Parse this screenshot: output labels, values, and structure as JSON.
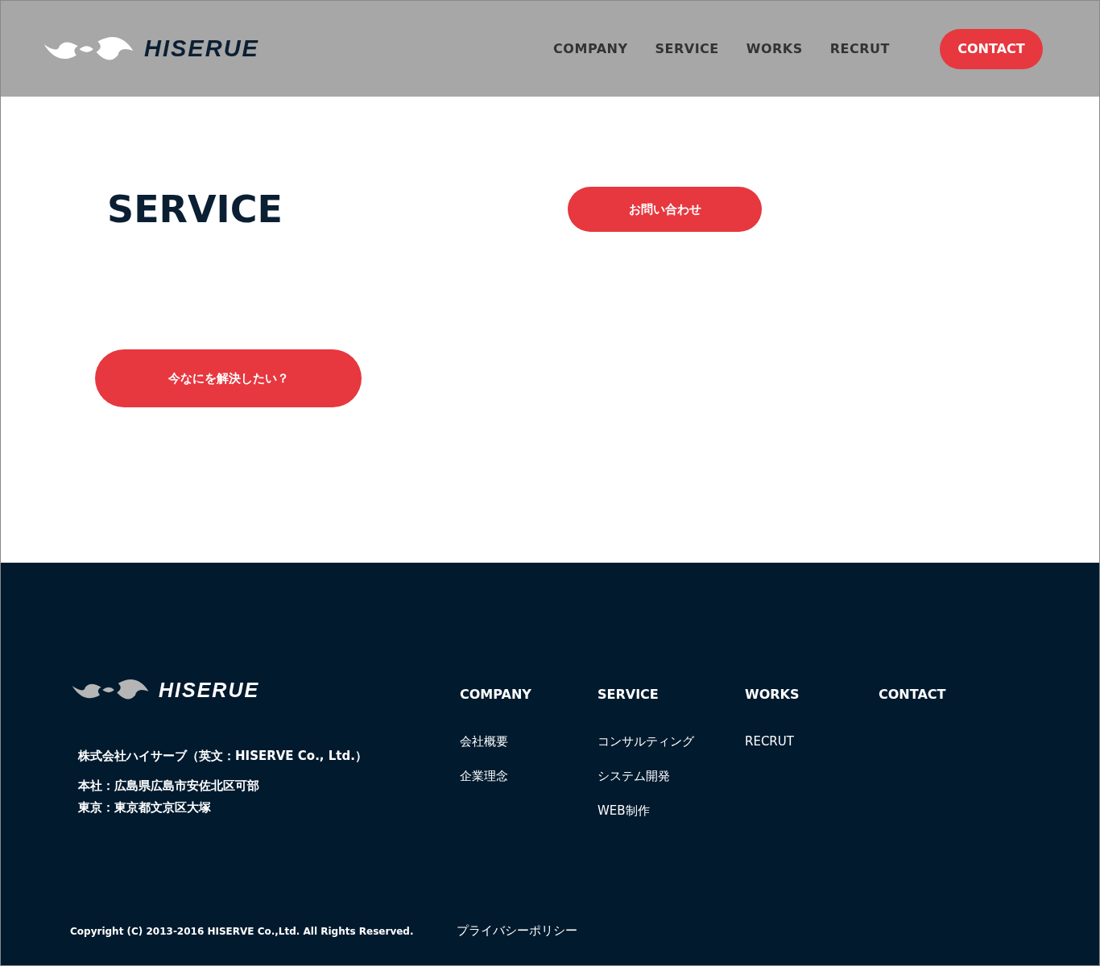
{
  "header": {
    "logo_text": "HISERUE",
    "nav": [
      "COMPANY",
      "SERVICE",
      "WORKS",
      "RECRUT"
    ],
    "contact_button": "CONTACT"
  },
  "main": {
    "title": "SERVICE",
    "inquiry_button": "お問い合わせ",
    "question_button": "今なにを解決したい？"
  },
  "footer": {
    "logo_text": "HISERUE",
    "company_name": "株式会社ハイサーブ（英文：HISERVE Co., Ltd.）",
    "addresses": [
      "本社：広島県広島市安佐北区可部",
      "東京：東京都文京区大塚"
    ],
    "columns": [
      {
        "heading": "COMPANY",
        "links": [
          "会社概要",
          "企業理念"
        ]
      },
      {
        "heading": "SERVICE",
        "links": [
          "コンサルティング",
          "システム開発",
          "WEB制作"
        ]
      },
      {
        "heading": "WORKS",
        "links": [
          "RECRUT"
        ]
      },
      {
        "heading": "CONTACT"
      }
    ],
    "copyright": "Copyright (C) 2013-2016 HISERVE Co.,Ltd. All Rights Reserved.",
    "privacy_link": "プライバシーポリシー"
  }
}
